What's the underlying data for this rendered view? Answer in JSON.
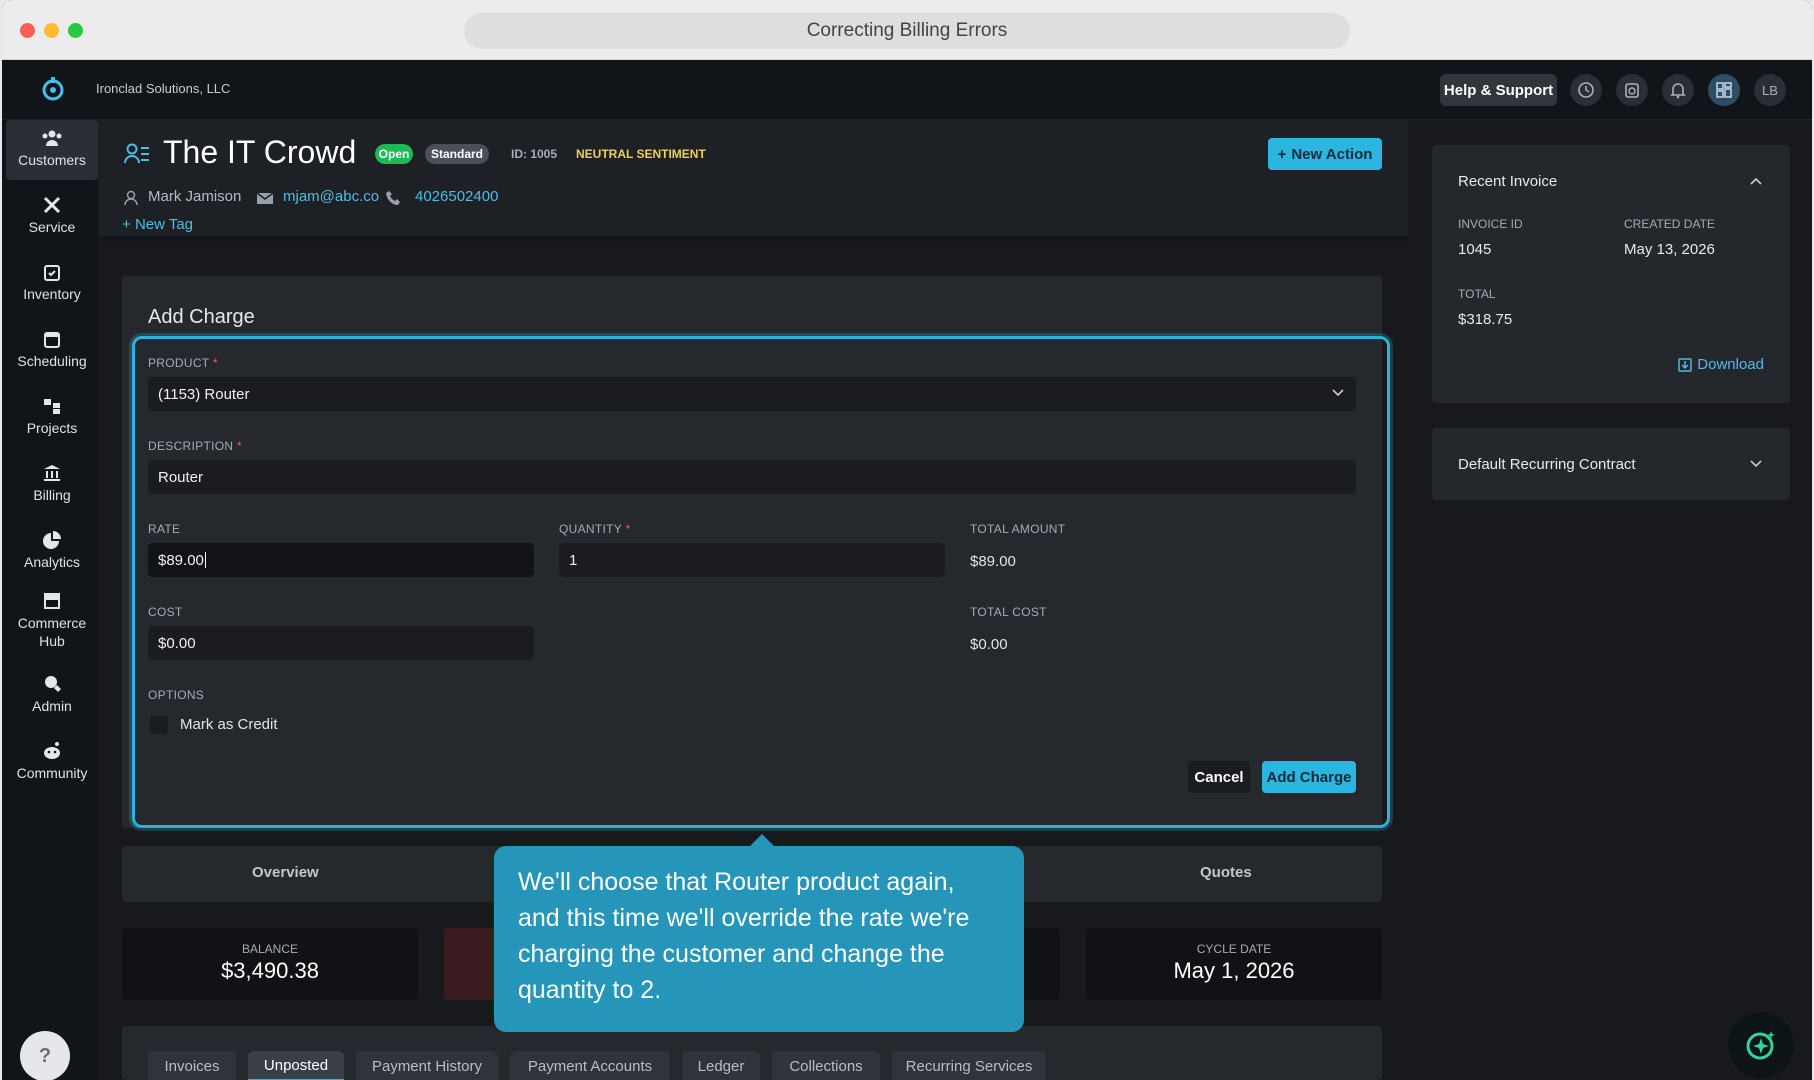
{
  "window": {
    "title": "Correcting Billing Errors"
  },
  "topbar": {
    "company": "Ironclad Solutions, LLC",
    "help_label": "Help & Support",
    "avatar_initials": "LB"
  },
  "sidebar": {
    "items": [
      {
        "label": "Customers",
        "icon": "customers-icon"
      },
      {
        "label": "Service",
        "icon": "service-icon"
      },
      {
        "label": "Inventory",
        "icon": "inventory-icon"
      },
      {
        "label": "Scheduling",
        "icon": "calendar-icon"
      },
      {
        "label": "Projects",
        "icon": "projects-icon"
      },
      {
        "label": "Billing",
        "icon": "bank-icon"
      },
      {
        "label": "Analytics",
        "icon": "pie-chart-icon"
      },
      {
        "label": "Commerce Hub",
        "icon": "store-icon"
      },
      {
        "label": "Admin",
        "icon": "admin-icon"
      },
      {
        "label": "Community",
        "icon": "community-icon"
      }
    ],
    "help_glyph": "?"
  },
  "customer": {
    "name": "The IT Crowd",
    "status": "Open",
    "tier": "Standard",
    "id_text": "ID: 1005",
    "sentiment": "NEUTRAL SENTIMENT",
    "contact_name": "Mark Jamison",
    "email": "mjam@abc.co",
    "phone": "4026502400",
    "new_tag": "New Tag",
    "new_action": "New Action"
  },
  "add_charge": {
    "title": "Add Charge",
    "product_label": "PRODUCT",
    "product_value": "(1153) Router",
    "description_label": "DESCRIPTION",
    "description_value": "Router",
    "rate_label": "RATE",
    "rate_value": "$89.00",
    "quantity_label": "QUANTITY",
    "quantity_value": "1",
    "total_amount_label": "TOTAL AMOUNT",
    "total_amount_value": "$89.00",
    "cost_label": "COST",
    "cost_value": "$0.00",
    "total_cost_label": "TOTAL COST",
    "total_cost_value": "$0.00",
    "options_label": "OPTIONS",
    "credit_label": "Mark as Credit",
    "required_mark": "*",
    "cancel_label": "Cancel",
    "submit_label": "Add Charge"
  },
  "strip": {
    "overview": "Overview",
    "quotes": "Quotes"
  },
  "stats": {
    "balance_label": "BALANCE",
    "balance_value": "$3,490.38",
    "cycle_label": "CYCLE DATE",
    "cycle_value": "May 1, 2026"
  },
  "bottom_tabs": [
    "Invoices",
    "Unposted",
    "Payment History",
    "Payment Accounts",
    "Ledger",
    "Collections",
    "Recurring Services"
  ],
  "tooltip": {
    "text": "We'll choose that Router product again, and this time we'll override the rate we're charging the customer and change the quantity to 2."
  },
  "recent_invoice": {
    "title": "Recent Invoice",
    "invoice_id_label": "INVOICE ID",
    "invoice_id": "1045",
    "created_label": "CREATED DATE",
    "created": "May 13, 2026",
    "total_label": "TOTAL",
    "total": "$318.75",
    "download": "Download"
  },
  "recurring": {
    "title": "Default Recurring Contract"
  },
  "colors": {
    "accent": "#2cb5df",
    "status_open": "#1db954",
    "sentiment": "#f1cf54",
    "tooltip": "#2596b9"
  }
}
